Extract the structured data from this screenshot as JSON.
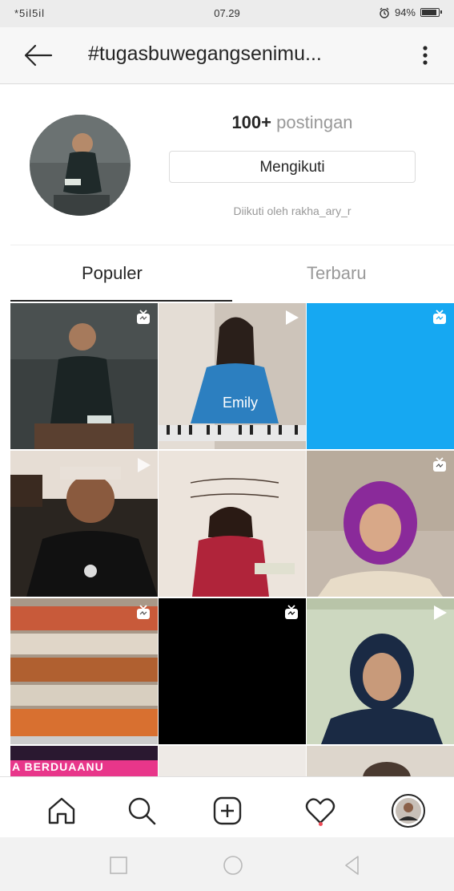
{
  "status_bar": {
    "signal": "*5il5il",
    "time": "07.29",
    "battery": "94%",
    "battery_level": 0.94
  },
  "header": {
    "title": "#tugasbuwegangsenimu..."
  },
  "profile": {
    "post_count": "100+",
    "post_label": "postingan",
    "follow_button": "Mengikuti",
    "followed_by": "Diikuti oleh rakha_ary_r"
  },
  "tabs": [
    {
      "label": "Populer",
      "active": true
    },
    {
      "label": "Terbaru",
      "active": false
    }
  ],
  "grid": [
    {
      "badge": "igtv-icon",
      "bg": "#3a4040"
    },
    {
      "badge": "play-icon",
      "bg": "#c8c0b8"
    },
    {
      "badge": "igtv-icon",
      "bg": "#16a8f2"
    },
    {
      "badge": "play-icon",
      "bg": "#2a2520"
    },
    {
      "badge": "none",
      "bg": "#e8e2dc"
    },
    {
      "badge": "igtv-icon",
      "bg": "#c0b4a8"
    },
    {
      "badge": "igtv-icon",
      "bg": "#b0a090"
    },
    {
      "badge": "igtv-icon",
      "bg": "#000000"
    },
    {
      "badge": "play-icon",
      "bg": "#c8d4b8"
    }
  ],
  "partial_row_text": "A BERDUAANU",
  "bottom_nav": [
    "home-icon",
    "search-icon",
    "add-post-icon",
    "activity-heart-icon",
    "profile-avatar"
  ],
  "system_nav": [
    "recent-apps-icon",
    "home-circle-icon",
    "back-triangle-icon"
  ],
  "colors": {
    "accent_dot": "#ed4956",
    "igtv_blue": "#16a8f2"
  }
}
